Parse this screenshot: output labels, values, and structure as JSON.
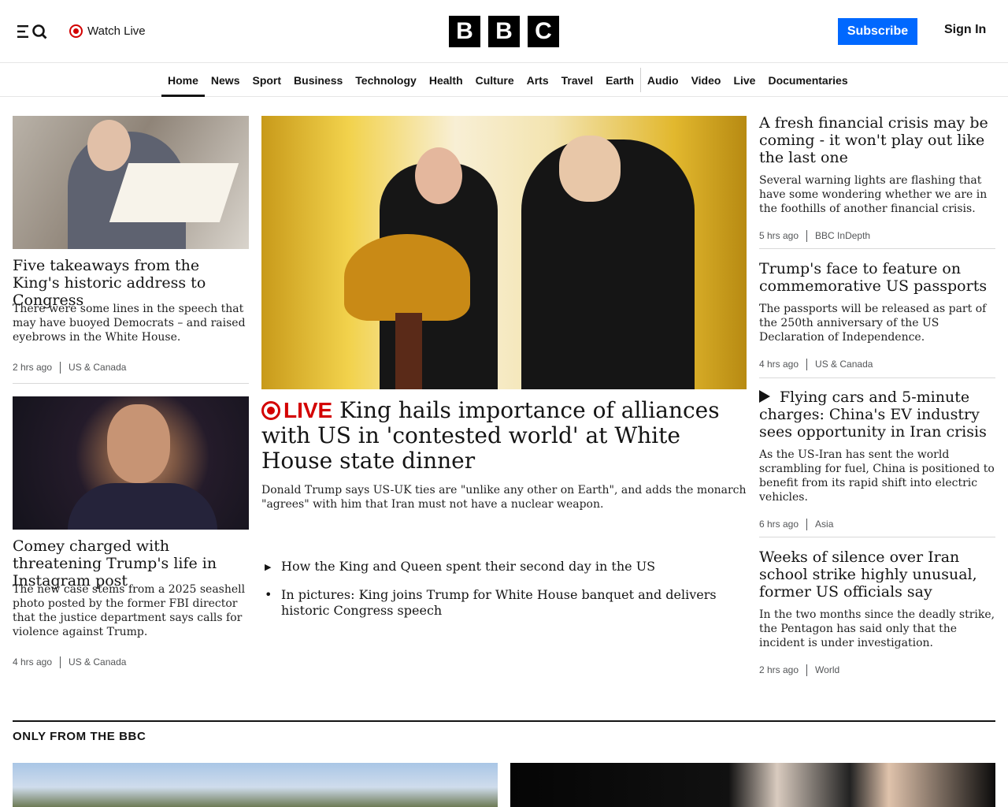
{
  "header": {
    "watch_live": "Watch Live",
    "logo_letters": [
      "B",
      "B",
      "C"
    ],
    "subscribe": "Subscribe",
    "sign_in": "Sign In"
  },
  "nav": {
    "items": [
      "Home",
      "News",
      "Sport",
      "Business",
      "Technology",
      "Health",
      "Culture",
      "Arts",
      "Travel",
      "Earth",
      "Audio",
      "Video",
      "Live",
      "Documentaries"
    ],
    "active": "Home"
  },
  "left_col": [
    {
      "headline": "Five takeaways from the King's historic address to Congress",
      "summary": "There were some lines in the speech that may have buoyed Democrats – and raised eyebrows in the White House.",
      "time": "2 hrs ago",
      "section": "US & Canada"
    },
    {
      "headline": "Comey charged with threatening Trump's life in Instagram post",
      "summary": "The new case stems from a 2025 seashell photo posted by the former FBI director that the justice department says calls for violence against Trump.",
      "time": "4 hrs ago",
      "section": "US & Canada"
    }
  ],
  "lead": {
    "live_label": "LIVE",
    "headline": "King hails importance of alliances with US in 'contested world' at White House state dinner",
    "summary": "Donald Trump says US-UK ties are \"unlike any other on Earth\", and adds the monarch \"agrees\" with him that Iran must not have a nuclear weapon.",
    "related": [
      {
        "icon": "play-icon",
        "text": "How the King and Queen spent their second day in the US"
      },
      {
        "icon": "bullet-icon",
        "text": "In pictures: King joins Trump for White House banquet and delivers historic Congress speech"
      }
    ]
  },
  "right_col": [
    {
      "headline": "A fresh financial crisis may be coming - it won't play out like the last one",
      "summary": "Several warning lights are flashing that have some wondering whether we are in the foothills of another financial crisis.",
      "time": "5 hrs ago",
      "section": "BBC InDepth"
    },
    {
      "headline": "Trump's face to feature on commemorative US passports",
      "summary": "The passports will be released as part of the 250th anniversary of the US Declaration of Independence.",
      "time": "4 hrs ago",
      "section": "US & Canada"
    },
    {
      "headline": "Flying cars and 5-minute charges: China's EV industry sees opportunity in Iran crisis",
      "summary": "As the US-Iran has sent the world scrambling for fuel, China is positioned to benefit from its rapid shift into electric vehicles.",
      "time": "6 hrs ago",
      "section": "Asia",
      "has_video": true
    },
    {
      "headline": "Weeks of silence over Iran school strike highly unusual, former US officials say",
      "summary": "In the two months since the deadly strike, the Pentagon has said only that the incident is under investigation.",
      "time": "2 hrs ago",
      "section": "World"
    }
  ],
  "only_from_bbc": {
    "title": "ONLY FROM THE BBC"
  },
  "colors": {
    "live_red": "#d30000",
    "subscribe_blue": "#0068ff",
    "text": "#141414",
    "meta": "#545658"
  }
}
